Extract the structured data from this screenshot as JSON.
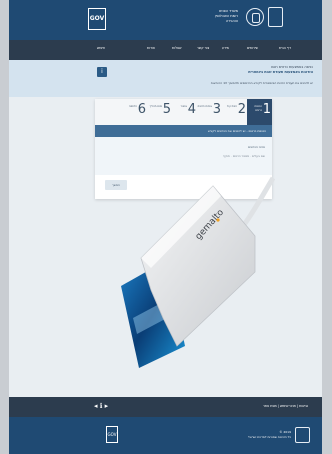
{
  "header": {
    "gov_logo": "GOV",
    "ministry": [
      "משרד הפנים",
      "רשות האוכלוסין",
      "וההגירה"
    ]
  },
  "nav": {
    "items": [
      "דף הבית",
      "שירותים",
      "מידע",
      "צור קשר",
      "שאלות",
      "אודות"
    ],
    "search": "חיפוש"
  },
  "info": {
    "page_title": "כניסה באמצעות כרטיס חכם",
    "subtitle": "הזדהות באמצעות תעודת זהות ביומטרית",
    "description": "יש להכניס את תעודת הזהות הביומטרית לקורא הכרטיסים ולהמשיך לפי ההוראות",
    "help_icon": "info-icon"
  },
  "wizard": {
    "steps": [
      {
        "number": "1",
        "label": "הכנסת כרטיס"
      },
      {
        "number": "2",
        "label": "הזנת קוד"
      },
      {
        "number": "3",
        "label": "אימות פרטים"
      },
      {
        "number": "4",
        "label": "אישור"
      },
      {
        "number": "5",
        "label": "סיום תהליך"
      },
      {
        "number": "6",
        "label": "הדפסה"
      }
    ],
    "active_step": 0,
    "bar_text": "הכנסת כרטיס - יש להכניס את הכרטיס לקורא",
    "form_title": "פרטי הכרטיס",
    "form_columns": "שם בעלים · מספר כרטיס · תוקף",
    "button": "המשך"
  },
  "footer_nav": {
    "links": "נגישות | תנאי שימוש | מפת אתר",
    "icons": "◂ ℹ ▸"
  },
  "footer": {
    "gov_logo": "GOV",
    "text": [
      "© 2019",
      "כל הזכויות שמורות למדינת ישראל"
    ]
  },
  "photo": {
    "brand": "gemalto"
  },
  "colors": {
    "header": "#1f4a73",
    "nav": "#2c3c4e",
    "info_strip": "#d4e3ef",
    "active_step": "#2c4a6c",
    "progress_bar": "#3f6d97"
  }
}
